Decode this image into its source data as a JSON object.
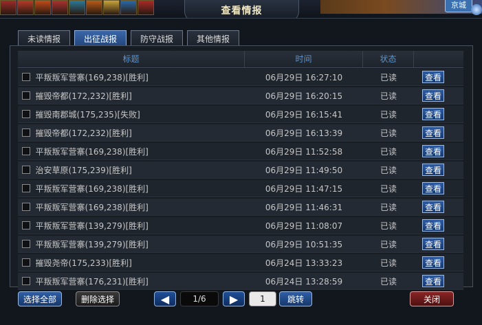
{
  "top": {
    "capital_label": "京城",
    "icons": [
      "flag-icon",
      "banner-icon",
      "banner-icon",
      "banner-icon",
      "gift-icon",
      "scroll-icon",
      "banner-icon",
      "banner-icon",
      "banner-icon"
    ]
  },
  "window": {
    "title": "查看情报"
  },
  "tabs": [
    {
      "label": "未读情报"
    },
    {
      "label": "出征战报"
    },
    {
      "label": "防守战报"
    },
    {
      "label": "其他情报"
    }
  ],
  "table": {
    "columns": [
      "标题",
      "时间",
      "状态",
      ""
    ],
    "view_label": "查看",
    "rows": [
      {
        "title": "平叛叛军营寨(169,238)[胜利]",
        "time": "06月29日 16:27:10",
        "status": "已读"
      },
      {
        "title": "摧毁帝都(172,232)[胜利]",
        "time": "06月29日 16:20:15",
        "status": "已读"
      },
      {
        "title": "摧毁南郡城(175,235)[失败]",
        "time": "06月29日 16:15:41",
        "status": "已读"
      },
      {
        "title": "摧毁帝都(172,232)[胜利]",
        "time": "06月29日 16:13:39",
        "status": "已读"
      },
      {
        "title": "平叛叛军营寨(169,238)[胜利]",
        "time": "06月29日 11:52:58",
        "status": "已读"
      },
      {
        "title": "治安草原(175,239)[胜利]",
        "time": "06月29日 11:49:50",
        "status": "已读"
      },
      {
        "title": "平叛叛军营寨(169,238)[胜利]",
        "time": "06月29日 11:47:15",
        "status": "已读"
      },
      {
        "title": "平叛叛军营寨(169,238)[胜利]",
        "time": "06月29日 11:46:31",
        "status": "已读"
      },
      {
        "title": "平叛叛军营寨(139,279)[胜利]",
        "time": "06月29日 11:08:07",
        "status": "已读"
      },
      {
        "title": "平叛叛军营寨(139,279)[胜利]",
        "time": "06月29日 10:51:35",
        "status": "已读"
      },
      {
        "title": "摧毁尧帝(175,233)[胜利]",
        "time": "06月24日 13:33:23",
        "status": "已读"
      },
      {
        "title": "平叛叛军营寨(176,231)[胜利]",
        "time": "06月24日 13:28:59",
        "status": "已读"
      }
    ]
  },
  "footer": {
    "select_all": "选择全部",
    "delete_selected": "删除选择",
    "prev": "◀",
    "page": "1/6",
    "next": "▶",
    "page_input": "1",
    "jump": "跳转",
    "close": "关闭"
  }
}
